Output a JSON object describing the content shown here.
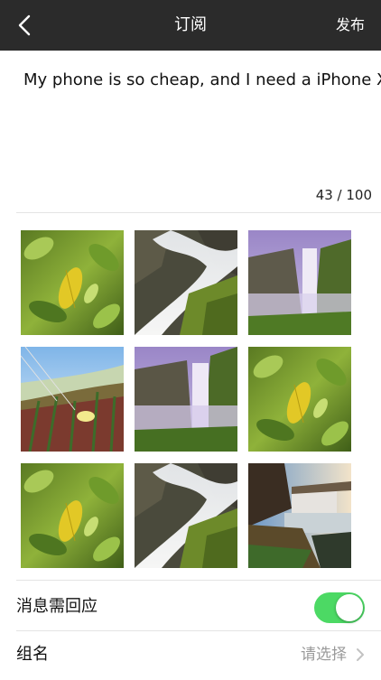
{
  "navbar": {
    "title": "订阅",
    "action_label": "发布",
    "back_icon": "chevron-left-icon",
    "background": "#2b2b2b"
  },
  "compose": {
    "text": "My phone is so cheap, and I need a iPhone X",
    "char_count": "43 / 100"
  },
  "images": [
    {
      "name": "leaf-photo"
    },
    {
      "name": "waterfall-photo"
    },
    {
      "name": "misty-waterfall-photo"
    },
    {
      "name": "flower-meadow-photo"
    },
    {
      "name": "misty-waterfall-photo"
    },
    {
      "name": "leaf-photo"
    },
    {
      "name": "leaf-photo"
    },
    {
      "name": "waterfall-photo"
    },
    {
      "name": "canyon-waterfall-photo"
    }
  ],
  "settings": {
    "reply_required": {
      "label": "消息需回应",
      "enabled": true,
      "accent": "#4cd964"
    },
    "group": {
      "label": "组名",
      "value": "请选择",
      "icon": "chevron-right-icon"
    }
  }
}
